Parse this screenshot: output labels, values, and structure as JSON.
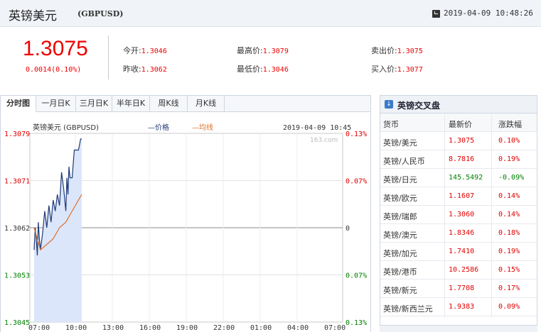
{
  "header": {
    "title": "英镑美元",
    "code": "(GBPUSD)",
    "datetime": "2019-04-09 10:48:26"
  },
  "quote": {
    "price": "1.3075",
    "change": "0.0014(0.10%)",
    "open_label": "今开:",
    "open": "1.3046",
    "prev_close_label": "昨收:",
    "prev_close": "1.3062",
    "high_label": "最高价:",
    "high": "1.3079",
    "low_label": "最低价:",
    "low": "1.3046",
    "ask_label": "卖出价:",
    "ask": "1.3075",
    "bid_label": "买入价:",
    "bid": "1.3077"
  },
  "tabs": [
    {
      "label": "分时图"
    },
    {
      "label": "一月日K"
    },
    {
      "label": "三月日K"
    },
    {
      "label": "半年日K"
    },
    {
      "label": "周K线"
    },
    {
      "label": "月K线"
    }
  ],
  "colors": {
    "up": "#e00000",
    "down": "#008000",
    "price_line": "#1f3a78",
    "avg_line": "#e0702a",
    "fill": "#dbe6fa"
  },
  "chart_data": {
    "type": "line",
    "title": "英镑美元 (GBPUSD)",
    "timestamp": "2019-04-09 10:45",
    "watermark": "163.com",
    "legend": [
      {
        "name": "价格",
        "prefix": "—"
      },
      {
        "name": "均线",
        "prefix": "—"
      }
    ],
    "ylim": [
      1.3045,
      1.3079
    ],
    "y_ticks_left": [
      "1.3079",
      "1.3071",
      "1.3062",
      "1.3053",
      "1.3045"
    ],
    "y_ticks_right": [
      "0.13%",
      "0.07%",
      "0",
      "0.07%",
      "0.13%"
    ],
    "x_ticks": [
      "07:00",
      "10:00",
      "13:00",
      "16:00",
      "19:00",
      "22:00",
      "01:00",
      "04:00",
      "07:00"
    ],
    "reference": 1.3062,
    "series": [
      {
        "name": "价格",
        "x": [
          "07:00",
          "07:05",
          "07:10",
          "07:15",
          "07:20",
          "07:25",
          "07:30",
          "07:40",
          "07:50",
          "08:00",
          "08:10",
          "08:20",
          "08:30",
          "08:40",
          "08:50",
          "09:00",
          "09:10",
          "09:20",
          "09:30",
          "09:35",
          "09:40",
          "09:45",
          "09:50",
          "10:00",
          "10:10",
          "10:20",
          "10:30",
          "10:40",
          "10:45"
        ],
        "values": [
          1.3058,
          1.3062,
          1.306,
          1.3057,
          1.3063,
          1.306,
          1.3058,
          1.3061,
          1.3065,
          1.3062,
          1.3066,
          1.3063,
          1.3067,
          1.3065,
          1.3068,
          1.3066,
          1.3072,
          1.3069,
          1.3065,
          1.3071,
          1.3068,
          1.3073,
          1.3071,
          1.3071,
          1.3076,
          1.3076,
          1.3076,
          1.3078,
          1.3078
        ]
      },
      {
        "name": "均线",
        "x": [
          "07:00",
          "07:30",
          "08:00",
          "08:30",
          "09:00",
          "09:30",
          "10:00",
          "10:30",
          "10:45"
        ],
        "values": [
          1.3062,
          1.3058,
          1.3059,
          1.306,
          1.3062,
          1.3063,
          1.3065,
          1.3067,
          1.3068
        ]
      }
    ]
  },
  "cross": {
    "title": "英镑交叉盘",
    "headers": [
      "货币",
      "最新价",
      "涨跌幅"
    ],
    "rows": [
      {
        "name": "英镑/美元",
        "price": "1.3075",
        "pct": "0.10%",
        "dir": "up"
      },
      {
        "name": "英镑/人民币",
        "price": "8.7816",
        "pct": "0.19%",
        "dir": "up"
      },
      {
        "name": "英镑/日元",
        "price": "145.5492",
        "pct": "-0.09%",
        "dir": "down"
      },
      {
        "name": "英镑/欧元",
        "price": "1.1607",
        "pct": "0.14%",
        "dir": "up"
      },
      {
        "name": "英镑/瑞郎",
        "price": "1.3060",
        "pct": "0.14%",
        "dir": "up"
      },
      {
        "name": "英镑/澳元",
        "price": "1.8346",
        "pct": "0.18%",
        "dir": "up"
      },
      {
        "name": "英镑/加元",
        "price": "1.7410",
        "pct": "0.19%",
        "dir": "up"
      },
      {
        "name": "英镑/港币",
        "price": "10.2586",
        "pct": "0.15%",
        "dir": "up"
      },
      {
        "name": "英镑/新元",
        "price": "1.7708",
        "pct": "0.17%",
        "dir": "up"
      },
      {
        "name": "英镑/新西兰元",
        "price": "1.9383",
        "pct": "0.09%",
        "dir": "up"
      }
    ]
  }
}
